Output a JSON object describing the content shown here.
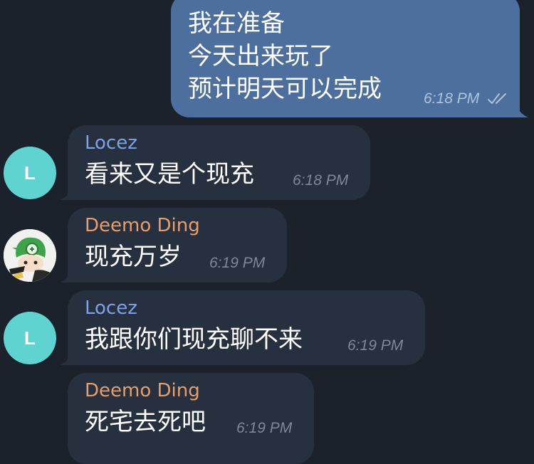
{
  "messages": [
    {
      "direction": "outgoing",
      "lines": [
        "我在准备",
        "今天出来玩了",
        "预计明天可以完成"
      ],
      "time": "6:18 PM",
      "status": "read"
    },
    {
      "direction": "incoming",
      "sender": "Locez",
      "sender_color": "#7ea2ea",
      "text": "看来又是个现充",
      "time": "6:18 PM",
      "avatar": {
        "type": "letter",
        "letter": "L",
        "color": "#5fd3d0"
      }
    },
    {
      "direction": "incoming",
      "sender": "Deemo Ding",
      "sender_color": "#e79e6a",
      "text": "现充万岁",
      "time": "6:19 PM",
      "avatar": {
        "type": "image",
        "icon": "anime-character-avatar"
      }
    },
    {
      "direction": "incoming",
      "sender": "Locez",
      "sender_color": "#7ea2ea",
      "text": "我跟你们现充聊不来",
      "time": "6:19 PM",
      "avatar": {
        "type": "letter",
        "letter": "L",
        "color": "#5fd3d0"
      }
    },
    {
      "direction": "incoming",
      "sender": "Deemo Ding",
      "sender_color": "#e79e6a",
      "text": "死宅去死吧",
      "time": "6:19 PM"
    }
  ],
  "colors": {
    "background": "#1c222b",
    "outgoing_bubble": "#4c6f9e",
    "incoming_bubble": "#27303e",
    "read_ticks": "#aec3dd"
  }
}
